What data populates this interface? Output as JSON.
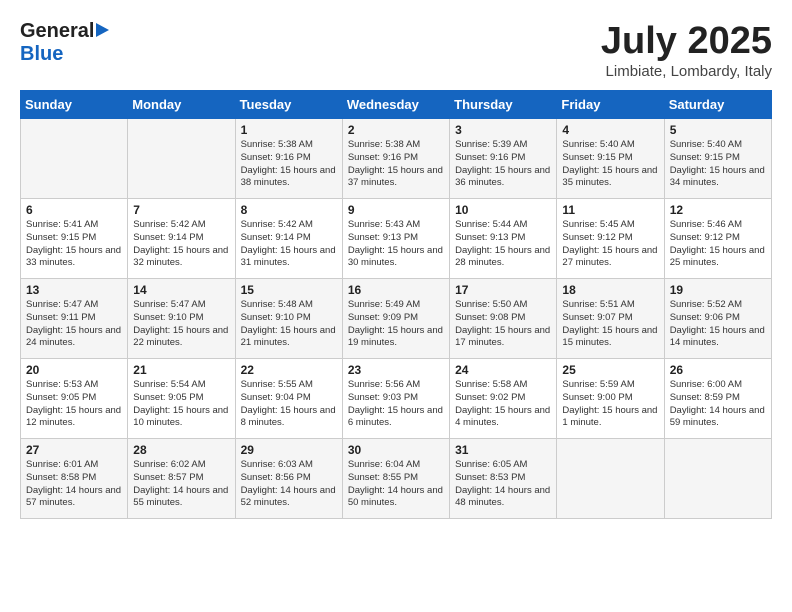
{
  "header": {
    "logo_general": "General",
    "logo_blue": "Blue",
    "month_title": "July 2025",
    "location": "Limbiate, Lombardy, Italy"
  },
  "weekdays": [
    "Sunday",
    "Monday",
    "Tuesday",
    "Wednesday",
    "Thursday",
    "Friday",
    "Saturday"
  ],
  "weeks": [
    [
      {
        "day": "",
        "sunrise": "",
        "sunset": "",
        "daylight": ""
      },
      {
        "day": "",
        "sunrise": "",
        "sunset": "",
        "daylight": ""
      },
      {
        "day": "1",
        "sunrise": "Sunrise: 5:38 AM",
        "sunset": "Sunset: 9:16 PM",
        "daylight": "Daylight: 15 hours and 38 minutes."
      },
      {
        "day": "2",
        "sunrise": "Sunrise: 5:38 AM",
        "sunset": "Sunset: 9:16 PM",
        "daylight": "Daylight: 15 hours and 37 minutes."
      },
      {
        "day": "3",
        "sunrise": "Sunrise: 5:39 AM",
        "sunset": "Sunset: 9:16 PM",
        "daylight": "Daylight: 15 hours and 36 minutes."
      },
      {
        "day": "4",
        "sunrise": "Sunrise: 5:40 AM",
        "sunset": "Sunset: 9:15 PM",
        "daylight": "Daylight: 15 hours and 35 minutes."
      },
      {
        "day": "5",
        "sunrise": "Sunrise: 5:40 AM",
        "sunset": "Sunset: 9:15 PM",
        "daylight": "Daylight: 15 hours and 34 minutes."
      }
    ],
    [
      {
        "day": "6",
        "sunrise": "Sunrise: 5:41 AM",
        "sunset": "Sunset: 9:15 PM",
        "daylight": "Daylight: 15 hours and 33 minutes."
      },
      {
        "day": "7",
        "sunrise": "Sunrise: 5:42 AM",
        "sunset": "Sunset: 9:14 PM",
        "daylight": "Daylight: 15 hours and 32 minutes."
      },
      {
        "day": "8",
        "sunrise": "Sunrise: 5:42 AM",
        "sunset": "Sunset: 9:14 PM",
        "daylight": "Daylight: 15 hours and 31 minutes."
      },
      {
        "day": "9",
        "sunrise": "Sunrise: 5:43 AM",
        "sunset": "Sunset: 9:13 PM",
        "daylight": "Daylight: 15 hours and 30 minutes."
      },
      {
        "day": "10",
        "sunrise": "Sunrise: 5:44 AM",
        "sunset": "Sunset: 9:13 PM",
        "daylight": "Daylight: 15 hours and 28 minutes."
      },
      {
        "day": "11",
        "sunrise": "Sunrise: 5:45 AM",
        "sunset": "Sunset: 9:12 PM",
        "daylight": "Daylight: 15 hours and 27 minutes."
      },
      {
        "day": "12",
        "sunrise": "Sunrise: 5:46 AM",
        "sunset": "Sunset: 9:12 PM",
        "daylight": "Daylight: 15 hours and 25 minutes."
      }
    ],
    [
      {
        "day": "13",
        "sunrise": "Sunrise: 5:47 AM",
        "sunset": "Sunset: 9:11 PM",
        "daylight": "Daylight: 15 hours and 24 minutes."
      },
      {
        "day": "14",
        "sunrise": "Sunrise: 5:47 AM",
        "sunset": "Sunset: 9:10 PM",
        "daylight": "Daylight: 15 hours and 22 minutes."
      },
      {
        "day": "15",
        "sunrise": "Sunrise: 5:48 AM",
        "sunset": "Sunset: 9:10 PM",
        "daylight": "Daylight: 15 hours and 21 minutes."
      },
      {
        "day": "16",
        "sunrise": "Sunrise: 5:49 AM",
        "sunset": "Sunset: 9:09 PM",
        "daylight": "Daylight: 15 hours and 19 minutes."
      },
      {
        "day": "17",
        "sunrise": "Sunrise: 5:50 AM",
        "sunset": "Sunset: 9:08 PM",
        "daylight": "Daylight: 15 hours and 17 minutes."
      },
      {
        "day": "18",
        "sunrise": "Sunrise: 5:51 AM",
        "sunset": "Sunset: 9:07 PM",
        "daylight": "Daylight: 15 hours and 15 minutes."
      },
      {
        "day": "19",
        "sunrise": "Sunrise: 5:52 AM",
        "sunset": "Sunset: 9:06 PM",
        "daylight": "Daylight: 15 hours and 14 minutes."
      }
    ],
    [
      {
        "day": "20",
        "sunrise": "Sunrise: 5:53 AM",
        "sunset": "Sunset: 9:05 PM",
        "daylight": "Daylight: 15 hours and 12 minutes."
      },
      {
        "day": "21",
        "sunrise": "Sunrise: 5:54 AM",
        "sunset": "Sunset: 9:05 PM",
        "daylight": "Daylight: 15 hours and 10 minutes."
      },
      {
        "day": "22",
        "sunrise": "Sunrise: 5:55 AM",
        "sunset": "Sunset: 9:04 PM",
        "daylight": "Daylight: 15 hours and 8 minutes."
      },
      {
        "day": "23",
        "sunrise": "Sunrise: 5:56 AM",
        "sunset": "Sunset: 9:03 PM",
        "daylight": "Daylight: 15 hours and 6 minutes."
      },
      {
        "day": "24",
        "sunrise": "Sunrise: 5:58 AM",
        "sunset": "Sunset: 9:02 PM",
        "daylight": "Daylight: 15 hours and 4 minutes."
      },
      {
        "day": "25",
        "sunrise": "Sunrise: 5:59 AM",
        "sunset": "Sunset: 9:00 PM",
        "daylight": "Daylight: 15 hours and 1 minute."
      },
      {
        "day": "26",
        "sunrise": "Sunrise: 6:00 AM",
        "sunset": "Sunset: 8:59 PM",
        "daylight": "Daylight: 14 hours and 59 minutes."
      }
    ],
    [
      {
        "day": "27",
        "sunrise": "Sunrise: 6:01 AM",
        "sunset": "Sunset: 8:58 PM",
        "daylight": "Daylight: 14 hours and 57 minutes."
      },
      {
        "day": "28",
        "sunrise": "Sunrise: 6:02 AM",
        "sunset": "Sunset: 8:57 PM",
        "daylight": "Daylight: 14 hours and 55 minutes."
      },
      {
        "day": "29",
        "sunrise": "Sunrise: 6:03 AM",
        "sunset": "Sunset: 8:56 PM",
        "daylight": "Daylight: 14 hours and 52 minutes."
      },
      {
        "day": "30",
        "sunrise": "Sunrise: 6:04 AM",
        "sunset": "Sunset: 8:55 PM",
        "daylight": "Daylight: 14 hours and 50 minutes."
      },
      {
        "day": "31",
        "sunrise": "Sunrise: 6:05 AM",
        "sunset": "Sunset: 8:53 PM",
        "daylight": "Daylight: 14 hours and 48 minutes."
      },
      {
        "day": "",
        "sunrise": "",
        "sunset": "",
        "daylight": ""
      },
      {
        "day": "",
        "sunrise": "",
        "sunset": "",
        "daylight": ""
      }
    ]
  ]
}
